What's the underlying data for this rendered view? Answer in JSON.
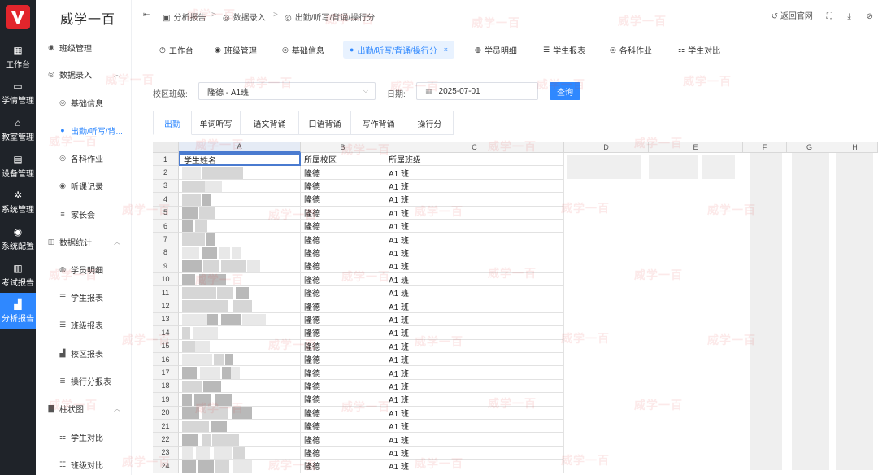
{
  "app": {
    "brand": "威学一百",
    "logo_letter": "V"
  },
  "rail": [
    {
      "icon": "grid-icon",
      "glyph": "▦",
      "label": "工作台",
      "active": false
    },
    {
      "icon": "monitor-icon",
      "glyph": "▭",
      "label": "学情管理",
      "active": false
    },
    {
      "icon": "bank-icon",
      "glyph": "⌂",
      "label": "教室管理",
      "active": false
    },
    {
      "icon": "device-icon",
      "glyph": "▤",
      "label": "设备管理",
      "active": false
    },
    {
      "icon": "gear-icon",
      "glyph": "✲",
      "label": "系统管理",
      "active": false
    },
    {
      "icon": "config-icon",
      "glyph": "◉",
      "label": "系统配置",
      "active": false
    },
    {
      "icon": "book-icon",
      "glyph": "▥",
      "label": "考试报告",
      "active": false
    },
    {
      "icon": "report-icon",
      "glyph": "▟",
      "label": "分析报告",
      "active": true
    }
  ],
  "side": {
    "items": [
      {
        "level": 1,
        "icon": "circle-dot-icon",
        "glyph": "◉",
        "label": "班级管理",
        "caret": ""
      },
      {
        "level": 1,
        "icon": "target-icon",
        "glyph": "◎",
        "label": "数据录入",
        "caret": "︿"
      },
      {
        "level": 2,
        "icon": "target-icon",
        "glyph": "◎",
        "label": "基础信息",
        "active": false
      },
      {
        "level": 2,
        "icon": "dot-icon",
        "glyph": "●",
        "label": "出勤/听写/背...",
        "active": true
      },
      {
        "level": 2,
        "icon": "target-icon",
        "glyph": "◎",
        "label": "各科作业",
        "active": false
      },
      {
        "level": 2,
        "icon": "circle-dot-icon",
        "glyph": "◉",
        "label": "听课记录",
        "active": false
      },
      {
        "level": 2,
        "icon": "list-icon",
        "glyph": "≡",
        "label": "家长会",
        "active": false
      },
      {
        "level": 1,
        "icon": "chart-icon",
        "glyph": "◫",
        "label": "数据统计",
        "caret": "︿"
      },
      {
        "level": 2,
        "icon": "person-icon",
        "glyph": "◍",
        "label": "学员明细",
        "active": false
      },
      {
        "level": 2,
        "icon": "table-icon",
        "glyph": "☰",
        "label": "学生报表",
        "active": false
      },
      {
        "level": 2,
        "icon": "table-icon",
        "glyph": "☰",
        "label": "班级报表",
        "active": false
      },
      {
        "level": 2,
        "icon": "bars-icon",
        "glyph": "▟",
        "label": "校区报表",
        "active": false
      },
      {
        "level": 2,
        "icon": "list-icon",
        "glyph": "≣",
        "label": "操行分报表",
        "active": false
      },
      {
        "level": 1,
        "icon": "bar-chart-icon",
        "glyph": "▇",
        "label": "柱状图",
        "caret": "︿"
      },
      {
        "level": 2,
        "icon": "compare-icon",
        "glyph": "⚏",
        "label": "学生对比",
        "active": false
      },
      {
        "level": 2,
        "icon": "list-icon",
        "glyph": "☷",
        "label": "班级对比",
        "active": false
      }
    ]
  },
  "topbar": {
    "toggle_glyph": "⇤",
    "crumbs": [
      {
        "icon": "folder-icon",
        "glyph": "▣",
        "label": "分析报告"
      },
      {
        "icon": "target-icon",
        "glyph": "◎",
        "label": "数据录入"
      },
      {
        "icon": "dot-icon",
        "glyph": "◎",
        "label": "出勤/听写/背诵/操行分"
      }
    ],
    "separator": ">",
    "back_glyph": "↺",
    "back_label": "返回官网",
    "fullscreen_glyph": "⛶",
    "download_glyph": "⤓",
    "clear_glyph": "⊘"
  },
  "tabs": [
    {
      "icon": "clock-icon",
      "glyph": "◷",
      "label": "工作台",
      "active": false
    },
    {
      "icon": "circle-dot-icon",
      "glyph": "◉",
      "label": "班级管理",
      "active": false
    },
    {
      "icon": "target-icon",
      "glyph": "◎",
      "label": "基础信息",
      "active": false
    },
    {
      "icon": "dot-icon",
      "glyph": "●",
      "label": "出勤/听写/背诵/操行分",
      "active": true,
      "close": "×"
    },
    {
      "icon": "person-icon",
      "glyph": "◍",
      "label": "学员明细",
      "active": false
    },
    {
      "icon": "table-icon",
      "glyph": "☰",
      "label": "学生报表",
      "active": false
    },
    {
      "icon": "target-icon",
      "glyph": "◎",
      "label": "各科作业",
      "active": false
    },
    {
      "icon": "compare-icon",
      "glyph": "⚏",
      "label": "学生对比",
      "active": false
    }
  ],
  "filters": {
    "campus_label": "校区班级:",
    "campus_value": "隆德 - A1班",
    "date_label": "日期:",
    "date_icon": "calendar-icon",
    "date_value": "2025-07-01",
    "query_label": "查询"
  },
  "sub_tabs": [
    "出勤",
    "单词听写",
    "语文背诵",
    "口语背诵",
    "写作背诵",
    "操行分"
  ],
  "sheet": {
    "columns": [
      "A",
      "B",
      "C",
      "D",
      "E",
      "F",
      "G",
      "H"
    ],
    "header": [
      "学生姓名",
      "所属校区",
      "所属班级"
    ],
    "row_numbers": [
      "1",
      "2",
      "3",
      "4",
      "5",
      "6",
      "7",
      "8",
      "9",
      "10",
      "11",
      "12",
      "13",
      "14",
      "15",
      "16",
      "17",
      "18",
      "19",
      "20",
      "21",
      "22",
      "23",
      "24"
    ],
    "campus": "隆德",
    "class_name": "A1 班"
  },
  "watermark": "威学一百"
}
